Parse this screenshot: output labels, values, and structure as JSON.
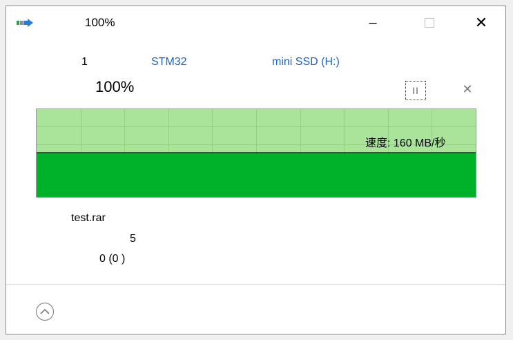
{
  "titlebar": {
    "title": "100%",
    "minimize_glyph": "–",
    "close_glyph": "✕",
    "icon": "copy-arrow-icon"
  },
  "transfer": {
    "item_count": "1",
    "from": "STM32",
    "to": "mini SSD (H:)",
    "percent_complete": "100%",
    "progress": 1.0,
    "pause_glyph": "II",
    "cancel_glyph": "✕"
  },
  "speed_graph": {
    "speed_label": "速度: 160 MB/秒",
    "fill_level": 0.5,
    "colors": {
      "fill": "#00b12a",
      "background": "#a9e49a",
      "grid": "#8fd07e",
      "line": "#000000"
    }
  },
  "details": {
    "file_name": "test.rar",
    "time_remaining": "5",
    "items_remaining": "0 (0      )"
  },
  "footer": {
    "expand_icon": "chevron-up-circle-icon"
  }
}
